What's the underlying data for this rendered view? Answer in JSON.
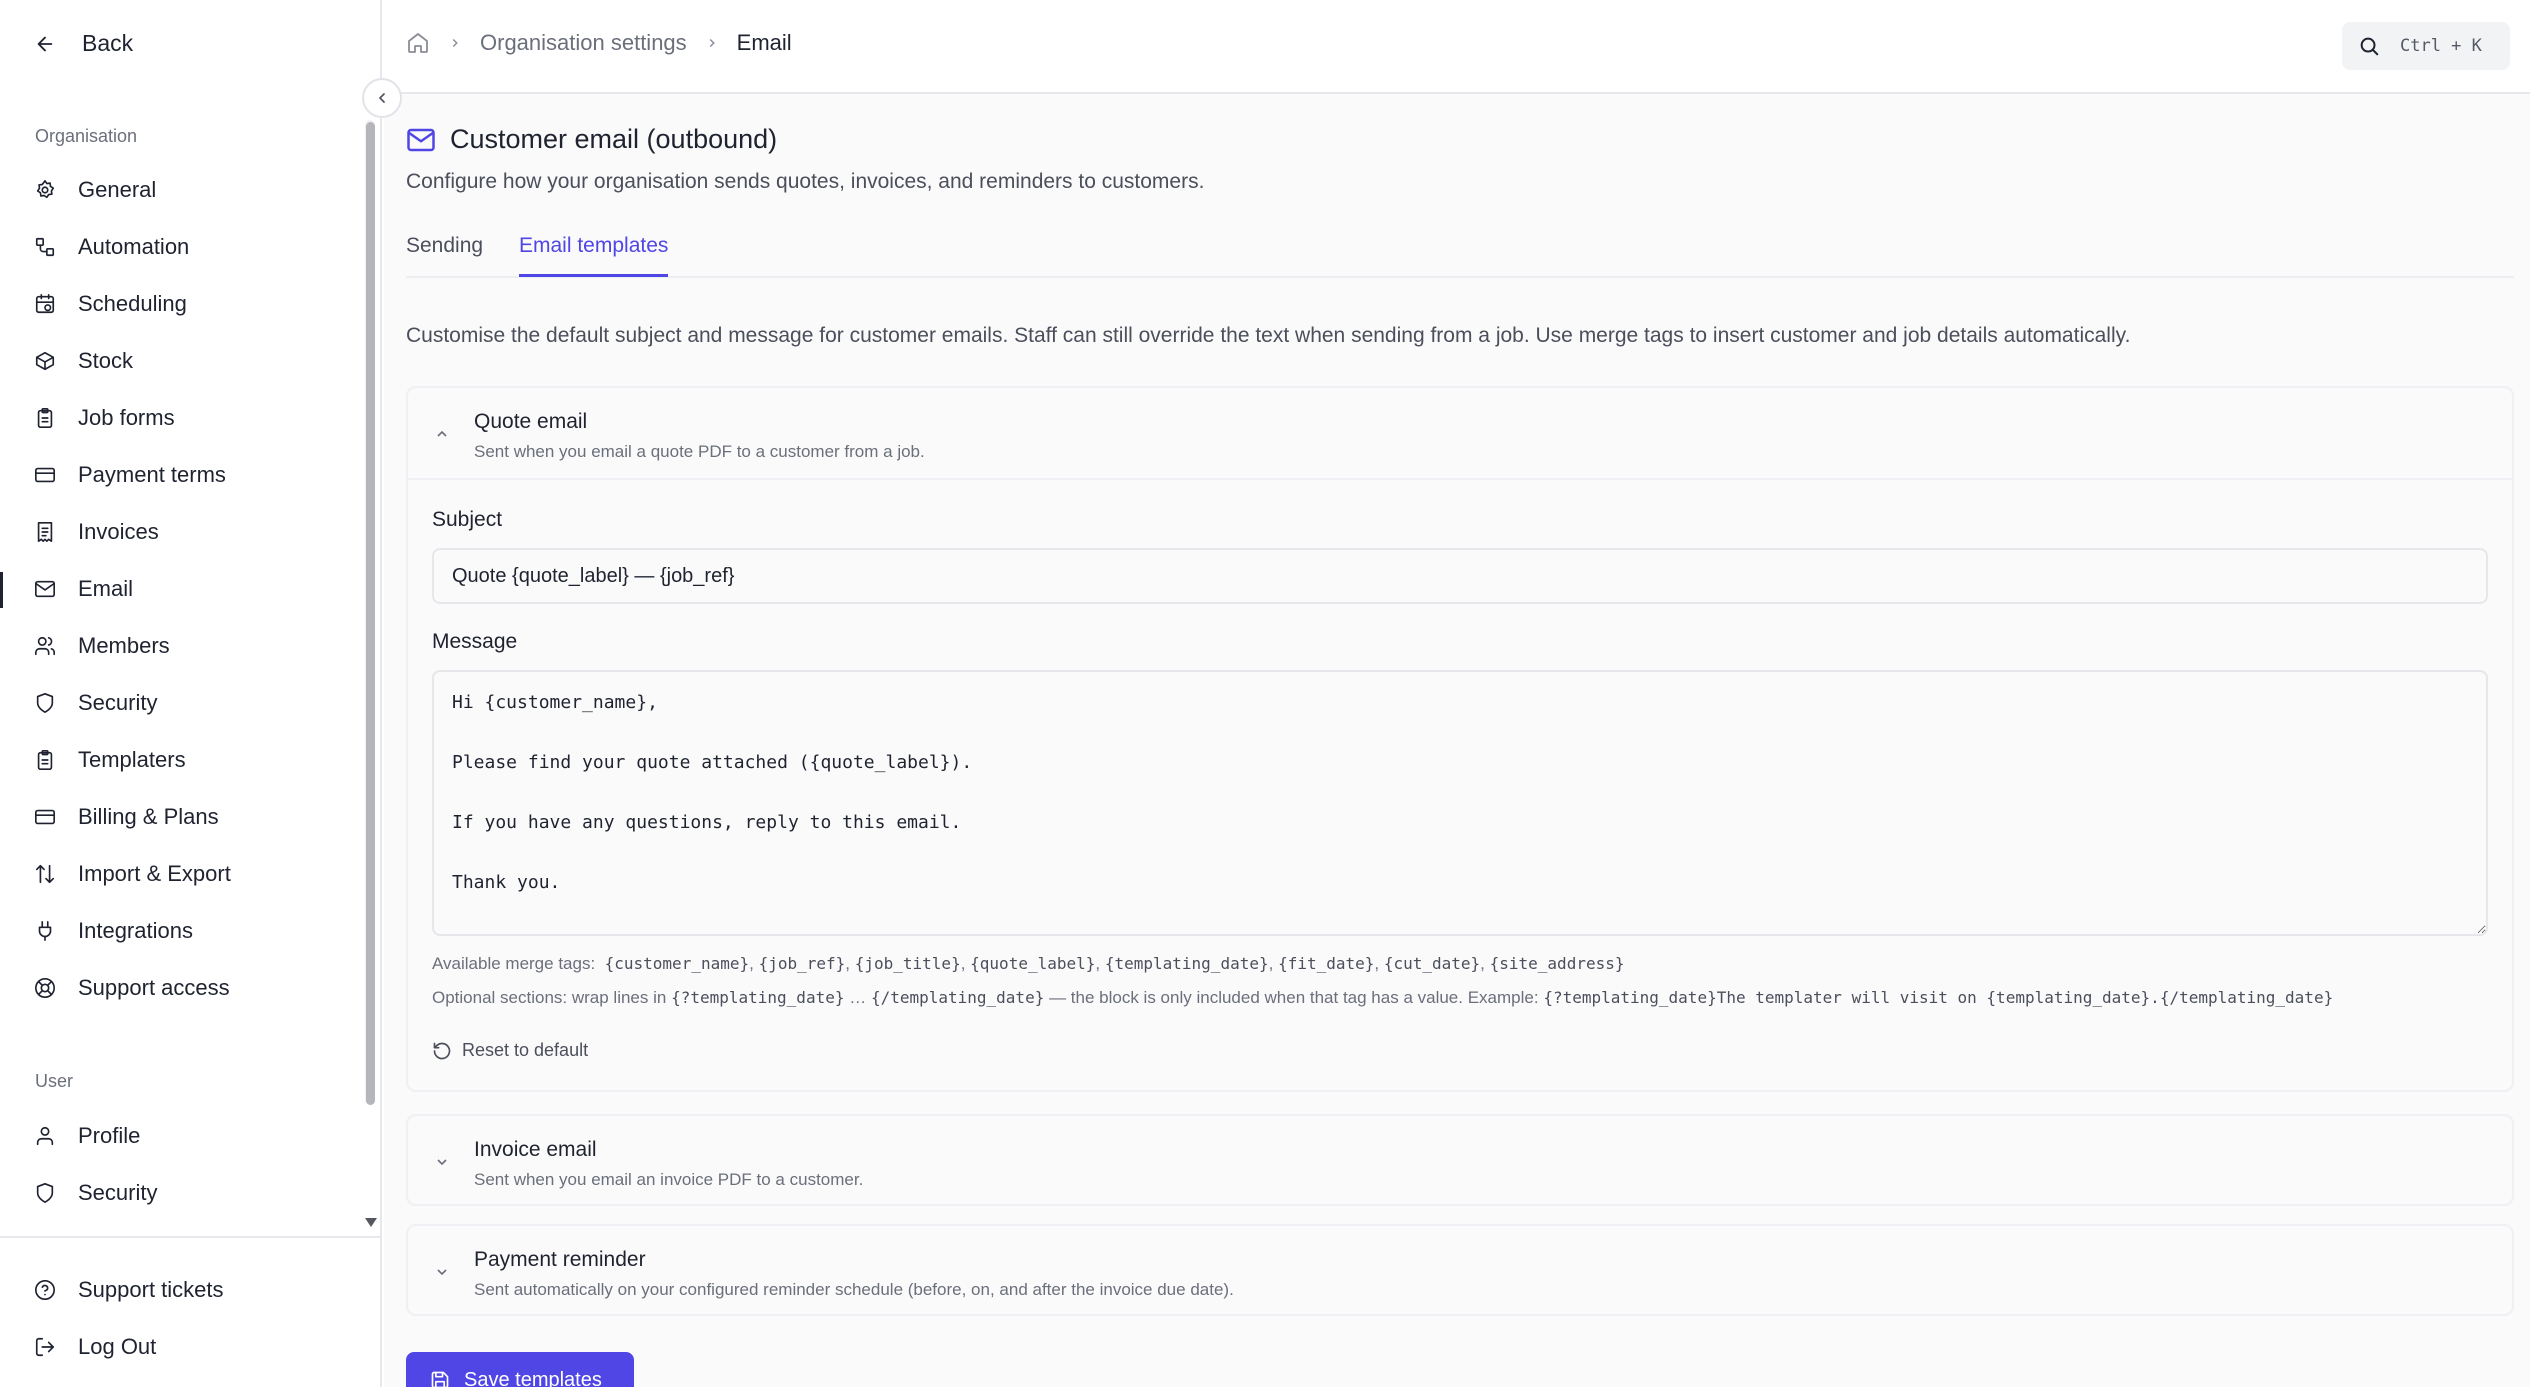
{
  "sidebar": {
    "back_label": "Back",
    "org_section_label": "Organisation",
    "org_items": [
      {
        "label": "General",
        "icon": "gear-icon"
      },
      {
        "label": "Automation",
        "icon": "workflow-icon"
      },
      {
        "label": "Scheduling",
        "icon": "calendar-icon"
      },
      {
        "label": "Stock",
        "icon": "package-icon"
      },
      {
        "label": "Job forms",
        "icon": "clipboard-icon"
      },
      {
        "label": "Payment terms",
        "icon": "credit-card-icon"
      },
      {
        "label": "Invoices",
        "icon": "receipt-icon"
      },
      {
        "label": "Email",
        "icon": "mail-icon",
        "active": true
      },
      {
        "label": "Members",
        "icon": "users-icon"
      },
      {
        "label": "Security",
        "icon": "shield-icon"
      },
      {
        "label": "Templaters",
        "icon": "clipboard-icon"
      },
      {
        "label": "Billing & Plans",
        "icon": "credit-card-icon"
      },
      {
        "label": "Import & Export",
        "icon": "arrows-up-down-icon"
      },
      {
        "label": "Integrations",
        "icon": "plug-icon"
      },
      {
        "label": "Support access",
        "icon": "lifebuoy-icon"
      }
    ],
    "user_section_label": "User",
    "user_items": [
      {
        "label": "Profile",
        "icon": "user-icon"
      },
      {
        "label": "Security",
        "icon": "shield-icon"
      }
    ],
    "footer_items": [
      {
        "label": "Support tickets",
        "icon": "help-circle-icon"
      },
      {
        "label": "Log Out",
        "icon": "log-out-icon"
      }
    ]
  },
  "topbar": {
    "breadcrumb": [
      "Organisation settings",
      "Email"
    ],
    "search_shortcut": "Ctrl + K"
  },
  "page": {
    "title": "Customer email (outbound)",
    "subtitle": "Configure how your organisation sends quotes, invoices, and reminders to customers.",
    "tabs": [
      "Sending",
      "Email templates"
    ],
    "active_tab": "Email templates",
    "intro": "Customise the default subject and message for customer emails. Staff can still override the text when sending from a job. Use merge tags to insert customer and job details automatically."
  },
  "quote_email": {
    "title": "Quote email",
    "description": "Sent when you email a quote PDF to a customer from a job.",
    "subject_label": "Subject",
    "subject_value": "Quote {quote_label} — {job_ref}",
    "message_label": "Message",
    "message_value": "Hi {customer_name},\n\nPlease find your quote attached ({quote_label}).\n\nIf you have any questions, reply to this email.\n\nThank you.",
    "merge_tags_label": "Available merge tags:",
    "merge_tags": [
      "{customer_name}",
      "{job_ref}",
      "{job_title}",
      "{quote_label}",
      "{templating_date}",
      "{fit_date}",
      "{cut_date}",
      "{site_address}"
    ],
    "optional_prefix": "Optional sections: wrap lines in",
    "optional_open": "{?templating_date}",
    "optional_ellipsis": "…",
    "optional_close": "{/templating_date}",
    "optional_middle": "— the block is only included when that tag has a value. Example:",
    "optional_example": "{?templating_date}The templater will visit on {templating_date}.{/templating_date}",
    "reset_label": "Reset to default"
  },
  "invoice_email": {
    "title": "Invoice email",
    "description": "Sent when you email an invoice PDF to a customer."
  },
  "payment_reminder": {
    "title": "Payment reminder",
    "description": "Sent automatically on your configured reminder schedule (before, on, and after the invoice due date)."
  },
  "save_label": "Save templates",
  "colors": {
    "accent": "#4f46e5",
    "text": "#1f2330",
    "muted": "#6b6f7b"
  }
}
